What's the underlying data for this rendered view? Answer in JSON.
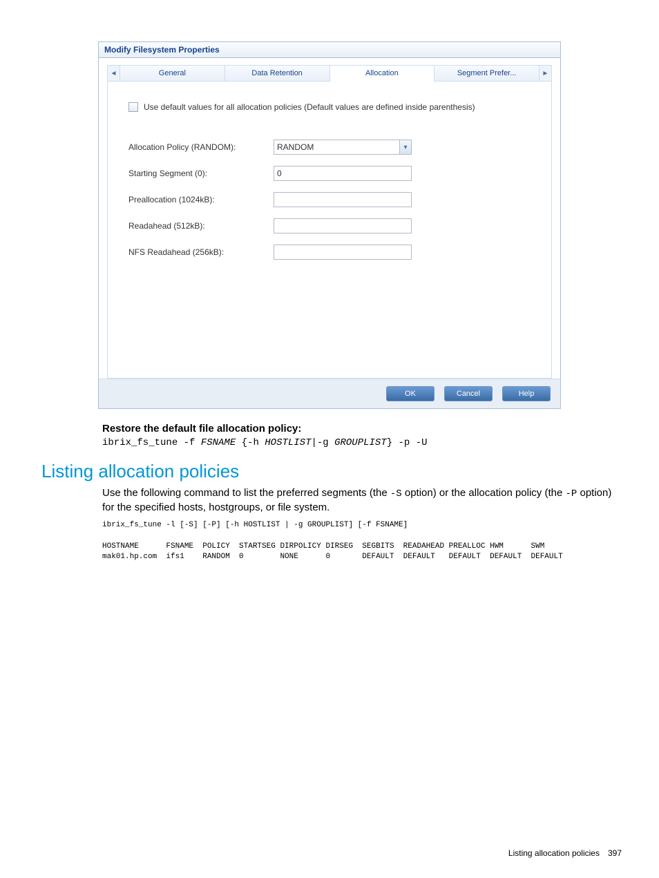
{
  "dialog": {
    "title": "Modify Filesystem Properties",
    "tabs": [
      "General",
      "Data Retention",
      "Allocation",
      "Segment Prefer..."
    ],
    "active_tab_index": 2,
    "use_defaults_label": "Use default values for all allocation policies (Default values are defined inside parenthesis)",
    "fields": {
      "alloc_policy": {
        "label": "Allocation Policy (RANDOM):",
        "value": "RANDOM"
      },
      "starting_segment": {
        "label": "Starting Segment (0):",
        "value": "0"
      },
      "prealloc": {
        "label": "Preallocation (1024kB):",
        "value": ""
      },
      "readahead": {
        "label": "Readahead (512kB):",
        "value": ""
      },
      "nfs_readahead": {
        "label": "NFS Readahead (256kB):",
        "value": ""
      }
    },
    "buttons": {
      "ok": "OK",
      "cancel": "Cancel",
      "help": "Help"
    }
  },
  "doc": {
    "restore_heading": "Restore the default file allocation policy:",
    "restore_cmd_prefix": "ibrix_fs_tune -f ",
    "restore_cmd_fsname": "FSNAME",
    "restore_cmd_mid1": " {-h ",
    "restore_cmd_hostlist": "HOSTLIST",
    "restore_cmd_mid2": "|-g ",
    "restore_cmd_grouplist": "GROUPLIST",
    "restore_cmd_suffix": "} -p -U",
    "section_heading": "Listing allocation policies",
    "body_part1": "Use the following command to list the preferred segments (the ",
    "body_opt_s": "-S",
    "body_part2": " option) or the allocation policy (the ",
    "body_opt_p": "-P",
    "body_part3": " option) for the specified hosts, hostgroups, or file system.",
    "cmd_block": "ibrix_fs_tune -l [-S] [-P] [-h HOSTLIST | -g GROUPLIST] [-f FSNAME]\n\nHOSTNAME      FSNAME  POLICY  STARTSEG DIRPOLICY DIRSEG  SEGBITS  READAHEAD PREALLOC HWM      SWM\nmak01.hp.com  ifs1    RANDOM  0        NONE      0       DEFAULT  DEFAULT   DEFAULT  DEFAULT  DEFAULT",
    "footer_text": "Listing allocation policies",
    "page_number": "397"
  }
}
